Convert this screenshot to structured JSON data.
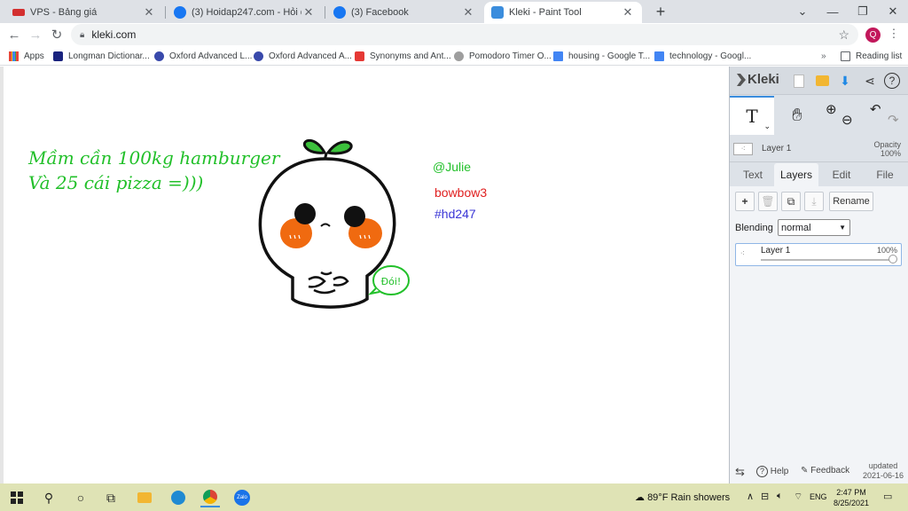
{
  "browser": {
    "tabs": [
      {
        "title": "VPS - Bảng giá",
        "favicon_color": "#d32f2f"
      },
      {
        "title": "(3) Hoidap247.com - Hỏi đáp bài",
        "favicon_color": "#1877f2"
      },
      {
        "title": "(3) Facebook",
        "favicon_color": "#1877f2"
      },
      {
        "title": "Kleki - Paint Tool",
        "favicon_color": "#3b8ddd"
      }
    ],
    "new_tab_label": "+",
    "url": "kleki.com",
    "profile_initial": "Q",
    "bookmarks": [
      {
        "label": "Apps",
        "icon": "apps-grid-icon"
      },
      {
        "label": "Longman Dictionar...",
        "icon": "longman-icon"
      },
      {
        "label": "Oxford Advanced L...",
        "icon": "oxford-icon"
      },
      {
        "label": "Oxford Advanced A...",
        "icon": "oxford-icon"
      },
      {
        "label": "Synonyms and Ant...",
        "icon": "thesaurus-icon"
      },
      {
        "label": "Pomodoro Timer O...",
        "icon": "timer-icon"
      },
      {
        "label": "housing - Google T...",
        "icon": "docs-icon"
      },
      {
        "label": "technology - Googl...",
        "icon": "docs-icon"
      }
    ],
    "reading_list": "Reading list"
  },
  "canvas": {
    "handwriting_line1": "Mầm cần 100kg hamburger",
    "handwriting_line2": "Và 25 cái pizza =)))",
    "speech_bubble": "Đói!",
    "text_julie": "@Julie",
    "text_bowbow": "bowbow3",
    "text_tag": "#hd247",
    "colors": {
      "green": "#22c02a",
      "red": "#e02020",
      "blue": "#3a36d6",
      "orange": "#f06a10",
      "leaf": "#3cc13c"
    }
  },
  "kleki": {
    "logo": "Kleki",
    "layer_name": "Layer 1",
    "opacity_label": "Opacity",
    "opacity_value": "100%",
    "tabs": [
      "Text",
      "Layers",
      "Edit",
      "File"
    ],
    "active_tab": "Layers",
    "rename_label": "Rename",
    "blending_label": "Blending",
    "blending_value": "normal",
    "layer_row_name": "Layer 1",
    "layer_row_opacity": "100%",
    "layer_opacity_fraction": 1.0,
    "help_label": "Help",
    "feedback_label": "Feedback",
    "updated_label": "updated",
    "updated_date": "2021-06-16"
  },
  "taskbar": {
    "weather": "89°F  Rain showers",
    "lang": "ENG",
    "time": "2:47 PM",
    "date": "8/25/2021"
  }
}
